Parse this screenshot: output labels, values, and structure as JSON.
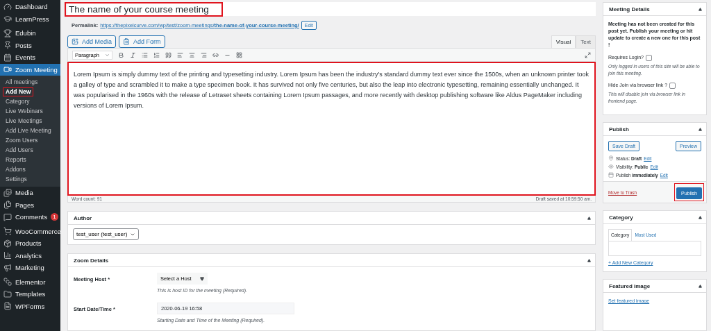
{
  "sidebar": {
    "groups": [
      {
        "items": [
          {
            "label": "Dashboard",
            "selected": false
          },
          {
            "label": "LearnPress",
            "selected": false
          }
        ]
      },
      {
        "items": [
          {
            "label": "Edubin",
            "selected": false
          },
          {
            "label": "Posts",
            "selected": false
          },
          {
            "label": "Events",
            "selected": false
          },
          {
            "label": "Zoom Meeting",
            "selected": true,
            "submenu": [
              {
                "label": "All meetings",
                "selected": false,
                "highlighted": false
              },
              {
                "label": "Add New",
                "selected": true,
                "highlighted": true
              },
              {
                "label": "Category",
                "selected": false,
                "highlighted": false
              },
              {
                "label": "Live Webinars",
                "selected": false,
                "highlighted": false
              },
              {
                "label": "Live Meetings",
                "selected": false,
                "highlighted": false
              },
              {
                "label": "Add Live Meeting",
                "selected": false,
                "highlighted": false
              },
              {
                "label": "Zoom Users",
                "selected": false,
                "highlighted": false
              },
              {
                "label": "Add Users",
                "selected": false,
                "highlighted": false
              },
              {
                "label": "Reports",
                "selected": false,
                "highlighted": false
              },
              {
                "label": "Addons",
                "selected": false,
                "highlighted": false
              },
              {
                "label": "Settings",
                "selected": false,
                "highlighted": false
              }
            ]
          },
          {
            "label": "Media",
            "selected": false
          },
          {
            "label": "Pages",
            "selected": false
          },
          {
            "label": "Comments",
            "selected": false,
            "badge": "1"
          }
        ]
      },
      {
        "items": [
          {
            "label": "WooCommerce",
            "selected": false
          },
          {
            "label": "Products",
            "selected": false
          },
          {
            "label": "Analytics",
            "selected": false
          },
          {
            "label": "Marketing",
            "selected": false
          }
        ]
      },
      {
        "items": [
          {
            "label": "Elementor",
            "selected": false
          },
          {
            "label": "Templates",
            "selected": false
          },
          {
            "label": "WPForms",
            "selected": false
          }
        ]
      }
    ]
  },
  "title": {
    "value": "The name of your course meeting",
    "highlighted": true
  },
  "permalink": {
    "label": "Permalink:",
    "base": "https://thepixelcurve.com/wp/test/zoom-meetings/",
    "slug": "the-name-of-your-course-meeting/",
    "edit": "Edit"
  },
  "media_buttons": [
    "Add Media",
    "Add Form"
  ],
  "editor_tabs": [
    {
      "label": "Visual",
      "selected": true
    },
    {
      "label": "Text",
      "selected": false
    }
  ],
  "format_select": "Paragraph",
  "editor": {
    "highlighted": true,
    "content": "Lorem Ipsum is simply dummy text of the printing and typesetting industry. Lorem Ipsum has been the industry's standard dummy text ever since the 1500s, when an unknown printer took a galley of type and scrambled it to make a type specimen book. It has survived not only five centuries, but also the leap into electronic typesetting, remaining essentially unchanged. It was popularised in the 1960s with the release of Letraset sheets containing Lorem Ipsum passages, and more recently with desktop publishing software like Aldus PageMaker including versions of Lorem Ipsum.",
    "word_count": "Word count: 91",
    "saved": "Draft saved at 10:59:50 am."
  },
  "author": {
    "title": "Author",
    "value": "test_user (test_user)"
  },
  "zoom_details": {
    "title": "Zoom Details",
    "fields": [
      {
        "kind": "select",
        "label": "Meeting Host *",
        "value": "Select a Host",
        "hint": "This is host ID for the meeting (Required)."
      },
      {
        "kind": "input",
        "label": "Start Date/Time *",
        "value": "2020-06-19 16:58",
        "hint": "Starting Date and Time of the Meeting (Required)."
      }
    ]
  },
  "meeting_details": {
    "title": "Meeting Details",
    "notice": "Meeting has not been created for this post yet. Publish your meeting or hit update to create a new one for this post !",
    "options": [
      {
        "label": "Requires Login?",
        "checked": false,
        "hint": "Only logged in users of this site will be able to join this meeting."
      },
      {
        "label": "Hide Join via browser link ?",
        "checked": false,
        "hint": "This will disable join via browser link in frontend page."
      }
    ]
  },
  "publish": {
    "title": "Publish",
    "save_draft": "Save Draft",
    "preview": "Preview",
    "rows": [
      {
        "text": "Status: **Draft**",
        "link": "Edit"
      },
      {
        "text": "Visibility: **Public**",
        "link": "Edit"
      },
      {
        "text": "Publish **immediately**",
        "link": "Edit"
      }
    ],
    "trash": "Move to Trash",
    "button": "Publish",
    "highlighted": true
  },
  "category": {
    "title": "Category",
    "tabs": [
      {
        "label": "Category",
        "selected": true
      },
      {
        "label": "Most Used",
        "selected": false
      }
    ],
    "add": "+ Add New Category"
  },
  "featured_image": {
    "title": "Featured image",
    "link": "Set featured image"
  }
}
